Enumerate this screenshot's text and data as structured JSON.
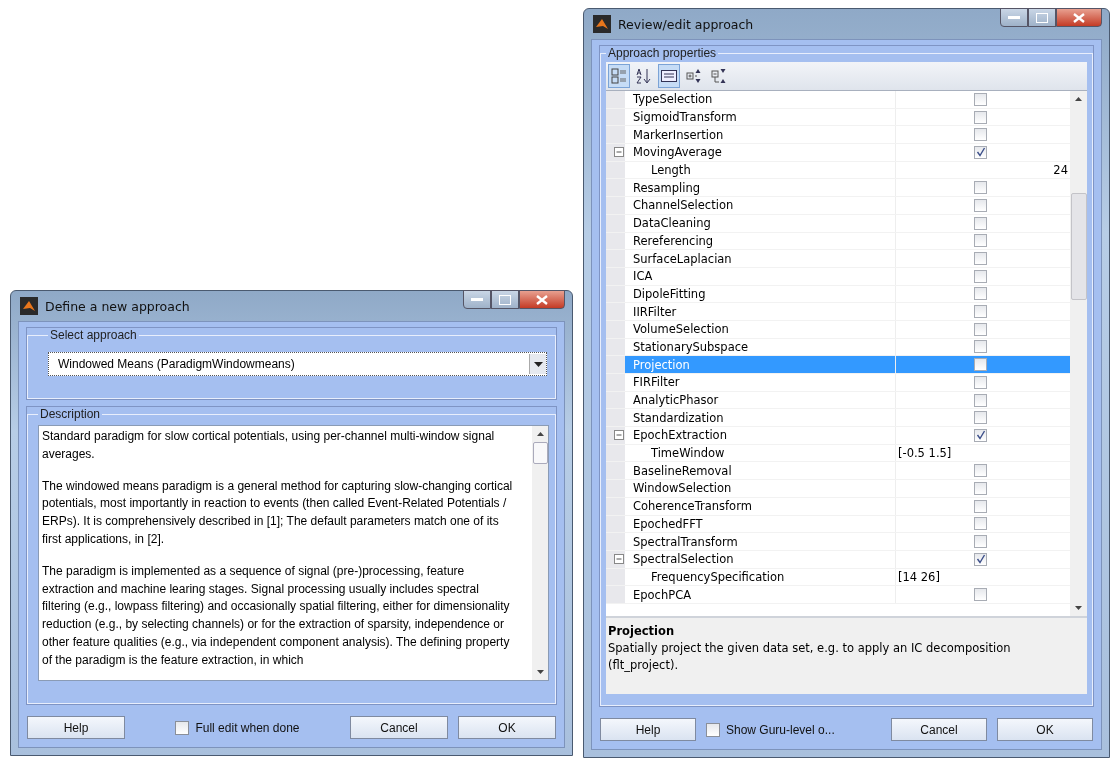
{
  "define_window": {
    "title": "Define a new approach",
    "select_group": {
      "label": "Select approach",
      "combo_value": "Windowed Means (ParadigmWindowmeans)"
    },
    "description_group": {
      "label": "Description",
      "paragraphs": [
        "Standard paradigm for slow cortical potentials, using per-channel multi-window signal averages.",
        "The windowed means paradigm is a general method for capturing slow-changing cortical potentials, most importantly in reaction to events (then called Event-Related Potentials / ERPs). It is comprehensively described in [1]; The default parameters match one of its first applications, in [2].",
        "The paradigm is implemented as a sequence of signal (pre-)processing, feature extraction and machine learing stages. Signal processing usually includes spectral filtering (e.g., lowpass filtering) and occasionally spatial filtering, either for dimensionality reduction (e.g., by selecting channels) or for the extraction of sparsity, independence or other feature qualities (e.g., via independent component analysis). The defining property of the paradigm is the feature extraction, in which"
      ]
    },
    "buttons": [
      {
        "kind": "button",
        "label": "Help"
      },
      {
        "kind": "checkbox",
        "label": "Full edit when done",
        "checked": false
      },
      {
        "kind": "button",
        "label": "Cancel"
      },
      {
        "kind": "button",
        "label": "OK"
      }
    ]
  },
  "review_window": {
    "title": "Review/edit approach",
    "group_label": "Approach properties",
    "toolbar": [
      {
        "kind": "categorized",
        "selected": true
      },
      {
        "kind": "alphabetical",
        "selected": false
      },
      {
        "kind": "description",
        "selected": true
      },
      {
        "kind": "expand",
        "selected": false
      },
      {
        "kind": "collapse",
        "selected": false
      }
    ],
    "properties": [
      {
        "name": "TypeSelection",
        "kind": "checkbox",
        "checked": false,
        "selected": false
      },
      {
        "name": "SigmoidTransform",
        "kind": "checkbox",
        "checked": false,
        "selected": false
      },
      {
        "name": "MarkerInsertion",
        "kind": "checkbox",
        "checked": false,
        "selected": false
      },
      {
        "name": "MovingAverage",
        "kind": "checkbox",
        "checked": true,
        "selected": false,
        "expanded": true,
        "children": [
          {
            "name": "Length",
            "kind": "number",
            "value": "24",
            "selected": false
          }
        ]
      },
      {
        "name": "Resampling",
        "kind": "checkbox",
        "checked": false,
        "selected": false
      },
      {
        "name": "ChannelSelection",
        "kind": "checkbox",
        "checked": false,
        "selected": false
      },
      {
        "name": "DataCleaning",
        "kind": "checkbox",
        "checked": false,
        "selected": false
      },
      {
        "name": "Rereferencing",
        "kind": "checkbox",
        "checked": false,
        "selected": false
      },
      {
        "name": "SurfaceLaplacian",
        "kind": "checkbox",
        "checked": false,
        "selected": false
      },
      {
        "name": "ICA",
        "kind": "checkbox",
        "checked": false,
        "selected": false
      },
      {
        "name": "DipoleFitting",
        "kind": "checkbox",
        "checked": false,
        "selected": false
      },
      {
        "name": "IIRFilter",
        "kind": "checkbox",
        "checked": false,
        "selected": false
      },
      {
        "name": "VolumeSelection",
        "kind": "checkbox",
        "checked": false,
        "selected": false
      },
      {
        "name": "StationarySubspace",
        "kind": "checkbox",
        "checked": false,
        "selected": false
      },
      {
        "name": "Projection",
        "kind": "checkbox",
        "checked": false,
        "selected": true
      },
      {
        "name": "FIRFilter",
        "kind": "checkbox",
        "checked": false,
        "selected": false
      },
      {
        "name": "AnalyticPhasor",
        "kind": "checkbox",
        "checked": false,
        "selected": false
      },
      {
        "name": "Standardization",
        "kind": "checkbox",
        "checked": false,
        "selected": false
      },
      {
        "name": "EpochExtraction",
        "kind": "checkbox",
        "checked": true,
        "selected": false,
        "expanded": true,
        "children": [
          {
            "name": "TimeWindow",
            "kind": "text",
            "value": "[-0.5 1.5]",
            "selected": false
          }
        ]
      },
      {
        "name": "BaselineRemoval",
        "kind": "checkbox",
        "checked": false,
        "selected": false
      },
      {
        "name": "WindowSelection",
        "kind": "checkbox",
        "checked": false,
        "selected": false
      },
      {
        "name": "CoherenceTransform",
        "kind": "checkbox",
        "checked": false,
        "selected": false
      },
      {
        "name": "EpochedFFT",
        "kind": "checkbox",
        "checked": false,
        "selected": false
      },
      {
        "name": "SpectralTransform",
        "kind": "checkbox",
        "checked": false,
        "selected": false
      },
      {
        "name": "SpectralSelection",
        "kind": "checkbox",
        "checked": true,
        "selected": false,
        "expanded": true,
        "children": [
          {
            "name": "FrequencySpecification",
            "kind": "text",
            "value": "[14 26]",
            "selected": false
          }
        ]
      },
      {
        "name": "EpochPCA",
        "kind": "checkbox",
        "checked": false,
        "selected": false
      }
    ],
    "help_panel": {
      "title": "Projection",
      "text": "Spatially project the given data set, e.g. to apply an IC decomposition (flt_project)."
    },
    "buttons": [
      {
        "kind": "button",
        "label": "Help"
      },
      {
        "kind": "checkbox",
        "label": "Show Guru-level o...",
        "checked": false
      },
      {
        "kind": "button",
        "label": "Cancel"
      },
      {
        "kind": "button",
        "label": "OK"
      }
    ]
  }
}
